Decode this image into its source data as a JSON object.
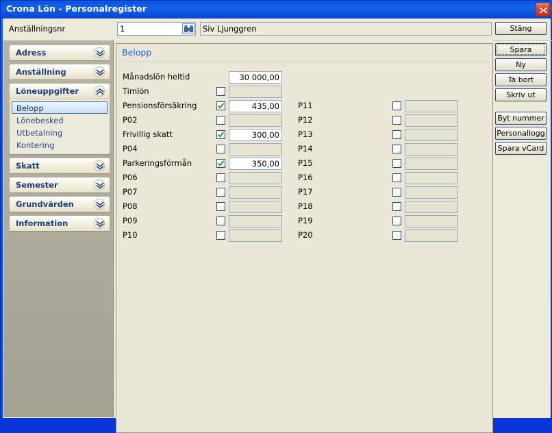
{
  "window": {
    "title": "Crona Lön - Personalregister",
    "close_icon": "close-icon"
  },
  "topbar": {
    "employee_number_label": "Anställningsnr",
    "employee_number_value": "1",
    "employee_number_placeholder": "",
    "search_icon": "binoculars-icon",
    "employee_name": "Siv Ljunggren"
  },
  "sidebar": {
    "groups": [
      {
        "label": "Adress",
        "expanded": false,
        "icon": "chevron-double-down-icon",
        "items": []
      },
      {
        "label": "Anställning",
        "expanded": false,
        "icon": "chevron-double-down-icon",
        "items": []
      },
      {
        "label": "Löneuppgifter",
        "expanded": true,
        "icon": "chevron-double-up-icon",
        "items": [
          {
            "label": "Belopp",
            "selected": true
          },
          {
            "label": "Lönebesked",
            "selected": false
          },
          {
            "label": "Utbetalning",
            "selected": false
          },
          {
            "label": "Kontering",
            "selected": false
          }
        ]
      },
      {
        "label": "Skatt",
        "expanded": false,
        "icon": "chevron-double-down-icon",
        "items": []
      },
      {
        "label": "Semester",
        "expanded": false,
        "icon": "chevron-double-down-icon",
        "items": []
      },
      {
        "label": "Grundvärden",
        "expanded": false,
        "icon": "chevron-double-down-icon",
        "items": []
      },
      {
        "label": "Information",
        "expanded": false,
        "icon": "chevron-double-down-icon",
        "items": []
      }
    ]
  },
  "main": {
    "section_title": "Belopp",
    "left_rows": [
      {
        "label": "Månadslön heltid",
        "has_checkbox": false,
        "checked": false,
        "value": "30 000,00",
        "enabled": true
      },
      {
        "label": "Timlön",
        "has_checkbox": true,
        "checked": false,
        "value": "",
        "enabled": false
      },
      {
        "label": "Pensionsförsäkring",
        "has_checkbox": true,
        "checked": true,
        "value": "435,00",
        "enabled": true
      },
      {
        "label": "P02",
        "has_checkbox": true,
        "checked": false,
        "value": "",
        "enabled": false
      },
      {
        "label": "Frivillig skatt",
        "has_checkbox": true,
        "checked": true,
        "value": "300,00",
        "enabled": true
      },
      {
        "label": "P04",
        "has_checkbox": true,
        "checked": false,
        "value": "",
        "enabled": false
      },
      {
        "label": "Parkeringsförmån",
        "has_checkbox": true,
        "checked": true,
        "value": "350,00",
        "enabled": true
      },
      {
        "label": "P06",
        "has_checkbox": true,
        "checked": false,
        "value": "",
        "enabled": false
      },
      {
        "label": "P07",
        "has_checkbox": true,
        "checked": false,
        "value": "",
        "enabled": false
      },
      {
        "label": "P08",
        "has_checkbox": true,
        "checked": false,
        "value": "",
        "enabled": false
      },
      {
        "label": "P09",
        "has_checkbox": true,
        "checked": false,
        "value": "",
        "enabled": false
      },
      {
        "label": "P10",
        "has_checkbox": true,
        "checked": false,
        "value": "",
        "enabled": false
      }
    ],
    "right_rows": [
      {
        "label": "P11",
        "has_checkbox": true,
        "checked": false,
        "value": "",
        "enabled": false
      },
      {
        "label": "P12",
        "has_checkbox": true,
        "checked": false,
        "value": "",
        "enabled": false
      },
      {
        "label": "P13",
        "has_checkbox": true,
        "checked": false,
        "value": "",
        "enabled": false
      },
      {
        "label": "P14",
        "has_checkbox": true,
        "checked": false,
        "value": "",
        "enabled": false
      },
      {
        "label": "P15",
        "has_checkbox": true,
        "checked": false,
        "value": "",
        "enabled": false
      },
      {
        "label": "P16",
        "has_checkbox": true,
        "checked": false,
        "value": "",
        "enabled": false
      },
      {
        "label": "P17",
        "has_checkbox": true,
        "checked": false,
        "value": "",
        "enabled": false
      },
      {
        "label": "P18",
        "has_checkbox": true,
        "checked": false,
        "value": "",
        "enabled": false
      },
      {
        "label": "P19",
        "has_checkbox": true,
        "checked": false,
        "value": "",
        "enabled": false
      },
      {
        "label": "P20",
        "has_checkbox": true,
        "checked": false,
        "value": "",
        "enabled": false
      }
    ]
  },
  "buttons": {
    "close": "Stäng",
    "group1": [
      "Spara",
      "Ny",
      "Ta bort",
      "Skriv ut"
    ],
    "group2": [
      "Byt nummer",
      "Personallogg",
      "Spara vCard"
    ],
    "focused": "Spara"
  },
  "colors": {
    "titlebar_blue": "#0b54e2",
    "frame_blue": "#0a3ed6",
    "sidebar_gray": "#aeaa9b",
    "panel_cream": "#eae7d7",
    "client_bg": "#ece9d8",
    "link_blue": "#1a5fd0",
    "group_title_blue": "#1b3f7d",
    "check_green": "#2e9b33",
    "close_red": "#c9301a"
  }
}
